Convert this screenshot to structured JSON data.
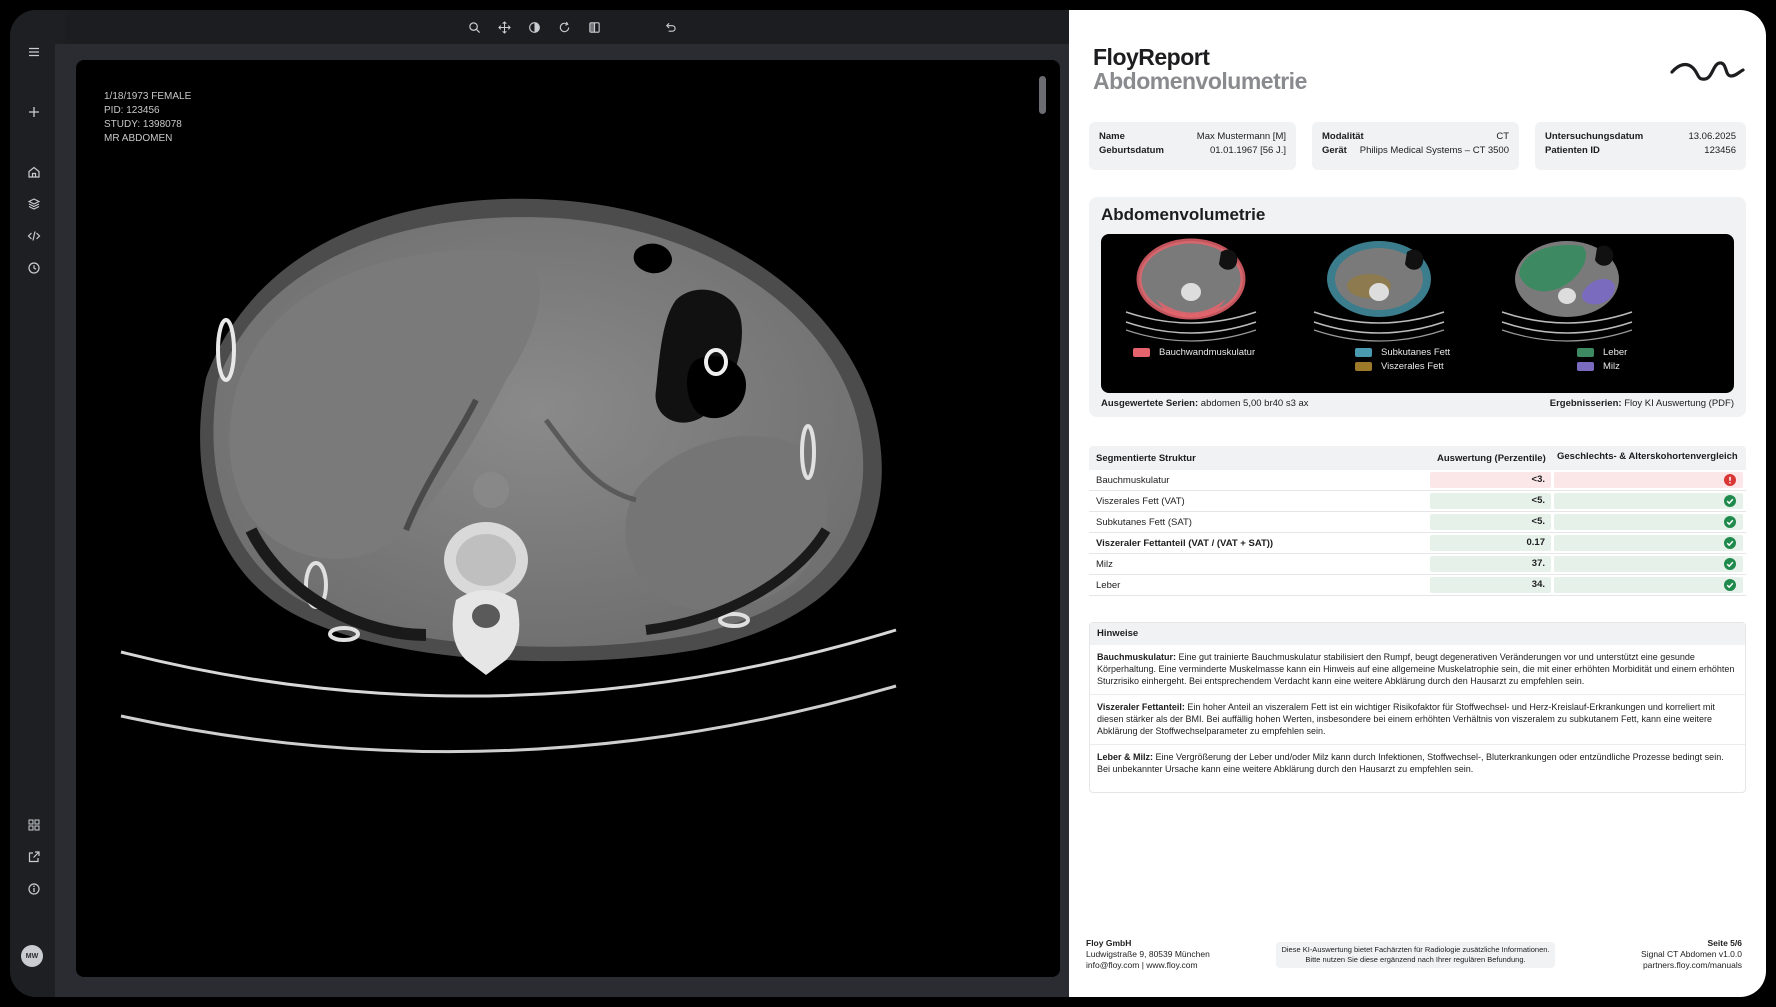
{
  "viewer": {
    "overlay": {
      "dob_sex": "1/18/1973 FEMALE",
      "pid": "PID: 123456",
      "study": "STUDY: 1398078",
      "series": "MR ABDOMEN"
    },
    "toolbar_icons": [
      "search-icon",
      "pan-icon",
      "contrast-icon",
      "rotate-icon",
      "split-view-icon",
      "undo-icon"
    ],
    "sidebar_icons_top": [
      "menu-icon",
      "plus-icon",
      "home-icon",
      "layers-icon",
      "code-icon",
      "history-icon"
    ],
    "sidebar_icons_bottom": [
      "grid-icon",
      "external-link-icon",
      "info-icon"
    ],
    "avatar_initials": "MW"
  },
  "report": {
    "title": "FloyReport",
    "subtitle": "Abdomenvolumetrie",
    "patient": {
      "name_label": "Name",
      "name_value": "Max Mustermann [M]",
      "dob_label": "Geburtsdatum",
      "dob_value": "01.01.1967 [56 J.]"
    },
    "modality": {
      "modality_label": "Modalität",
      "modality_value": "CT",
      "device_label": "Gerät",
      "device_value": "Philips Medical Systems – CT 3500"
    },
    "exam": {
      "date_label": "Untersuchungsdatum",
      "date_value": "13.06.2025",
      "pid_label": "Patienten ID",
      "pid_value": "123456"
    },
    "volumetry": {
      "title": "Abdomenvolumetrie",
      "legend": {
        "muscle": "Bauchwandmuskulatur",
        "sat": "Subkutanes Fett",
        "vat": "Viszerales Fett",
        "liver": "Leber",
        "spleen": "Milz"
      },
      "colors": {
        "muscle": "#e4636c",
        "sat": "#4a9bb0",
        "vat": "#9c7a2a",
        "liver": "#3d8a62",
        "spleen": "#7b6bbf"
      },
      "series_label": "Ausgewertete Serien:",
      "series_value": "abdomen 5,00 br40 s3 ax",
      "result_label": "Ergebnisserien:",
      "result_value": "Floy KI Auswertung (PDF)"
    },
    "table": {
      "headers": [
        "Segmentierte Struktur",
        "Auswertung (Perzentile)",
        "Geschlechts- & Alterskohortenvergleich"
      ],
      "rows": [
        {
          "name": "Bauchmuskulatur",
          "value": "<3.",
          "status": "warn"
        },
        {
          "name": "Viszerales Fett (VAT)",
          "value": "<5.",
          "status": "ok"
        },
        {
          "name": "Subkutanes Fett (SAT)",
          "value": "<5.",
          "status": "ok"
        },
        {
          "name": "Viszeraler Fettanteil (VAT / (VAT + SAT))",
          "value": "0.17",
          "status": "ok"
        },
        {
          "name": "Milz",
          "value": "37.",
          "status": "ok"
        },
        {
          "name": "Leber",
          "value": "34.",
          "status": "ok"
        }
      ]
    },
    "notes": {
      "title": "Hinweise",
      "items": [
        {
          "head": "Bauchmuskulatur:",
          "text": " Eine gut trainierte Bauchmuskulatur stabilisiert den Rumpf, beugt degenerativen Veränderungen vor und unterstützt eine gesunde Körperhaltung. Eine verminderte Muskelmasse kann ein Hinweis auf eine allgemeine Muskelatrophie sein, die mit einer erhöhten Morbidität und einem erhöhten Sturzrisiko einhergeht. Bei entsprechendem Verdacht kann eine weitere Abklärung durch den Hausarzt zu empfehlen sein."
        },
        {
          "head": "Viszeraler Fettanteil:",
          "text": " Ein hoher Anteil an viszeralem Fett ist ein wichtiger Risikofaktor für Stoffwechsel- und Herz-Kreislauf-Erkrankungen und korreliert mit diesen stärker als der BMI. Bei auffällig hohen Werten, insbesondere bei einem erhöhten Verhältnis von viszeralem zu subkutanem Fett, kann eine weitere Abklärung der Stoffwechselparameter zu empfehlen sein."
        },
        {
          "head": "Leber & Milz:",
          "text": " Eine Vergrößerung der Leber und/oder Milz kann durch Infektionen, Stoffwechsel-, Bluterkrankungen oder entzündliche Prozesse bedingt sein. Bei unbekannter Ursache kann eine weitere Abklärung durch den Hausarzt zu empfehlen sein."
        }
      ]
    },
    "footer": {
      "company": "Floy GmbH",
      "address": "Ludwigstraße 9, 80539 München",
      "contact": "info@floy.com | www.floy.com",
      "disclaimer_1": "Diese KI-Auswertung bietet Fachärzten für Radiologie zusätzliche Informationen.",
      "disclaimer_2": "Bitte nutzen Sie diese ergänzend nach Ihrer regulären Befundung.",
      "page": "Seite 5/6",
      "product": "Signal CT Abdomen v1.0.0",
      "manual": "partners.floy.com/manuals"
    }
  }
}
